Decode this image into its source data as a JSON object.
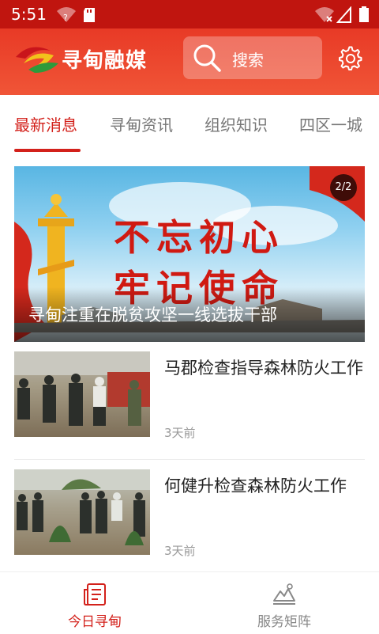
{
  "status_bar": {
    "time": "5:51"
  },
  "header": {
    "app_name": "寻甸融媒",
    "search_placeholder": "搜索"
  },
  "tabs": [
    {
      "label": "最新消息",
      "active": true
    },
    {
      "label": "寻甸资讯",
      "active": false
    },
    {
      "label": "组织知识",
      "active": false
    },
    {
      "label": "四区一城",
      "active": false
    }
  ],
  "banner": {
    "counter": "2/2",
    "slogan_line1": "不忘初心",
    "slogan_line2": "牢记使命",
    "caption": "寻甸注重在脱贫攻坚一线选拔干部"
  },
  "news": [
    {
      "title": "马郡检查指导森林防火工作",
      "time": "3天前"
    },
    {
      "title": "何健升检查森林防火工作",
      "time": "3天前"
    }
  ],
  "bottom_nav": [
    {
      "label": "今日寻甸",
      "active": true,
      "icon": "news-icon"
    },
    {
      "label": "服务矩阵",
      "active": false,
      "icon": "mountain-icon"
    }
  ],
  "colors": {
    "status_bar": "#c0150f",
    "header": "#e83a26",
    "accent": "#d3211b"
  }
}
